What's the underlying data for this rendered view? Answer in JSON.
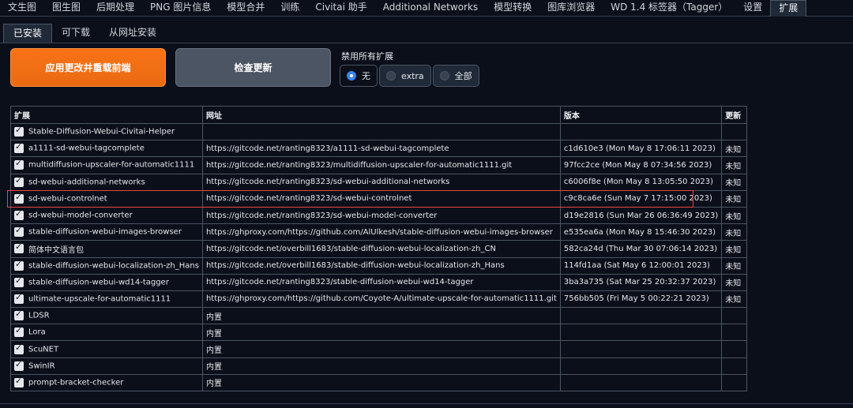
{
  "topnav": {
    "tabs": [
      {
        "label": "文生图"
      },
      {
        "label": "图生图"
      },
      {
        "label": "后期处理"
      },
      {
        "label": "PNG 图片信息"
      },
      {
        "label": "模型合并"
      },
      {
        "label": "训练"
      },
      {
        "label": "Civitai 助手"
      },
      {
        "label": "Additional Networks"
      },
      {
        "label": "模型转换"
      },
      {
        "label": "图库浏览器"
      },
      {
        "label": "WD 1.4 标签器（Tagger）"
      },
      {
        "label": "设置"
      },
      {
        "label": "扩展"
      }
    ],
    "active_index": 12
  },
  "subtabs": [
    {
      "label": "已安装"
    },
    {
      "label": "可下载"
    },
    {
      "label": "从网址安装"
    }
  ],
  "actions": {
    "apply_label": "应用更改并重载前端",
    "check_label": "检查更新"
  },
  "disable_all": {
    "label": "禁用所有扩展",
    "options": [
      "无",
      "extra",
      "全部"
    ],
    "selected": "无"
  },
  "table": {
    "headers": [
      "扩展",
      "网址",
      "版本",
      "更新"
    ],
    "rows": [
      {
        "name": "Stable-Diffusion-Webui-Civitai-Helper",
        "url": "",
        "version": "",
        "update": ""
      },
      {
        "name": "a1111-sd-webui-tagcomplete",
        "url": "https://gitcode.net/ranting8323/a1111-sd-webui-tagcomplete",
        "version": "c1d610e3 (Mon May 8 17:06:11 2023)",
        "update": "未知"
      },
      {
        "name": "multidiffusion-upscaler-for-automatic1111",
        "url": "https://gitcode.net/ranting8323/multidiffusion-upscaler-for-automatic1111.git",
        "version": "97fcc2ce (Mon May 8 07:34:56 2023)",
        "update": "未知"
      },
      {
        "name": "sd-webui-additional-networks",
        "url": "https://gitcode.net/ranting8323/sd-webui-additional-networks",
        "version": "c6006f8e (Mon May 8 13:05:50 2023)",
        "update": "未知"
      },
      {
        "name": "sd-webui-controlnet",
        "url": "https://gitcode.net/ranting8323/sd-webui-controlnet",
        "version": "c9c8ca6e (Sun May 7 17:15:00 2023)",
        "update": "未知"
      },
      {
        "name": "sd-webui-model-converter",
        "url": "https://gitcode.net/ranting8323/sd-webui-model-converter",
        "version": "d19e2816 (Sun Mar 26 06:36:49 2023)",
        "update": "未知"
      },
      {
        "name": "stable-diffusion-webui-images-browser",
        "url": "https://ghproxy.com/https://github.com/AlUlkesh/stable-diffusion-webui-images-browser",
        "version": "e535ea6a (Mon May 8 15:46:30 2023)",
        "update": "未知"
      },
      {
        "name": "简体中文语言包",
        "url": "https://gitcode.net/overbill1683/stable-diffusion-webui-localization-zh_CN",
        "version": "582ca24d (Thu Mar 30 07:06:14 2023)",
        "update": "未知"
      },
      {
        "name": "stable-diffusion-webui-localization-zh_Hans",
        "url": "https://gitcode.net/overbill1683/stable-diffusion-webui-localization-zh_Hans",
        "version": "114fd1aa (Sat May 6 12:00:01 2023)",
        "update": "未知"
      },
      {
        "name": "stable-diffusion-webui-wd14-tagger",
        "url": "https://gitcode.net/ranting8323/stable-diffusion-webui-wd14-tagger",
        "version": "3ba3a735 (Sat Mar 25 20:32:37 2023)",
        "update": "未知"
      },
      {
        "name": "ultimate-upscale-for-automatic1111",
        "url": "https://ghproxy.com/https://github.com/Coyote-A/ultimate-upscale-for-automatic1111.git",
        "version": "756bb505 (Fri May 5 00:22:21 2023)",
        "update": "未知"
      },
      {
        "name": "LDSR",
        "url": "内置",
        "version": "",
        "update": ""
      },
      {
        "name": "Lora",
        "url": "内置",
        "version": "",
        "update": ""
      },
      {
        "name": "ScuNET",
        "url": "内置",
        "version": "",
        "update": ""
      },
      {
        "name": "SwinIR",
        "url": "内置",
        "version": "",
        "update": ""
      },
      {
        "name": "prompt-bracket-checker",
        "url": "内置",
        "version": "",
        "update": ""
      }
    ]
  },
  "colors": {
    "accent": "#f97316",
    "highlight_box": "#ef4444",
    "radio_selected": "#3b82f6"
  }
}
